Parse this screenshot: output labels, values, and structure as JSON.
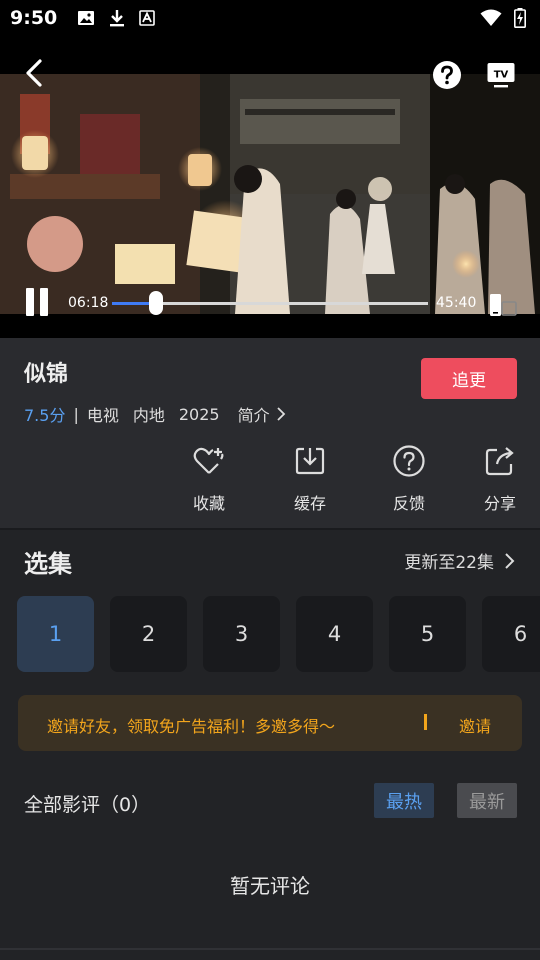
{
  "status_bar": {
    "time": "9:50",
    "icons": [
      "image-icon",
      "download-icon",
      "font-icon",
      "wifi-icon",
      "battery-charging-icon"
    ]
  },
  "player": {
    "current_time": "06:18",
    "total_time": "45:40",
    "progress": 0.138,
    "accent": "#3f7bf5"
  },
  "show": {
    "title": "似锦",
    "follow_label": "追更",
    "score": "7.5分",
    "separator": "|",
    "type": "电视",
    "region": "内地",
    "year": "2025",
    "brief_label": "简介"
  },
  "actions": [
    {
      "label": "收藏",
      "icon": "heart-plus-icon"
    },
    {
      "label": "缓存",
      "icon": "download-box-icon"
    },
    {
      "label": "反馈",
      "icon": "question-icon"
    },
    {
      "label": "分享",
      "icon": "share-icon"
    }
  ],
  "episodes": {
    "title": "选集",
    "update_text": "更新至22集",
    "items": [
      "1",
      "2",
      "3",
      "4",
      "5",
      "6"
    ],
    "active_index": 0
  },
  "invite": {
    "text": "邀请好友，领取免广告福利！多邀多得～",
    "button": "邀请"
  },
  "reviews": {
    "title": "全部影评（0）",
    "tab_hot": "最热",
    "tab_new": "最新",
    "empty_text": "暂无评论"
  },
  "colors": {
    "follow_button": "#ee4d5e",
    "score": "#5aa0f0",
    "invite_text": "#f2a51c",
    "background": "#222326"
  }
}
